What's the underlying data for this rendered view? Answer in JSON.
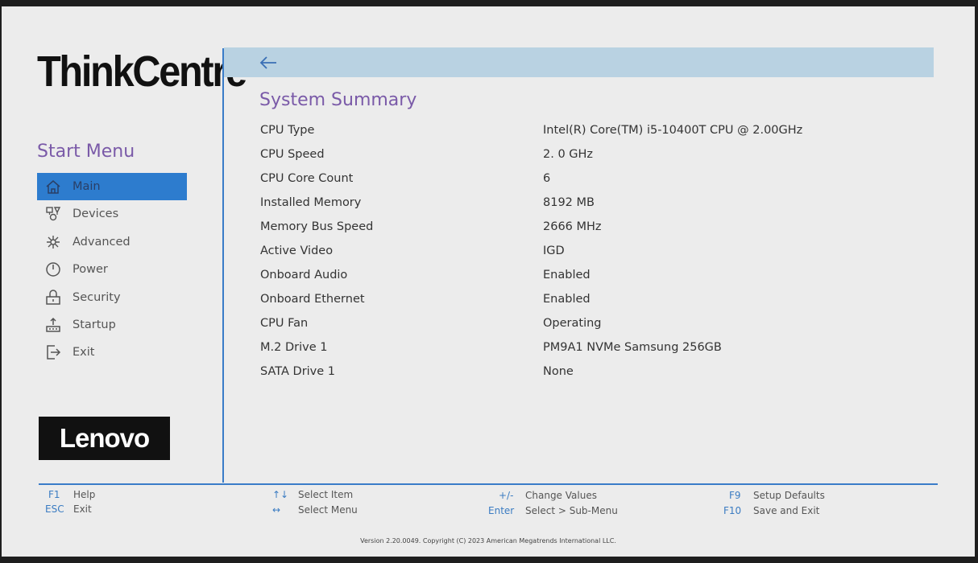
{
  "brand": {
    "name": "ThinkCentre",
    "vendor_logo": "Lenovo"
  },
  "sidebar": {
    "title": "Start Menu",
    "items": [
      {
        "label": "Main",
        "icon": "home-icon",
        "selected": true
      },
      {
        "label": "Devices",
        "icon": "devices-icon",
        "selected": false
      },
      {
        "label": "Advanced",
        "icon": "advanced-icon",
        "selected": false
      },
      {
        "label": "Power",
        "icon": "power-icon",
        "selected": false
      },
      {
        "label": "Security",
        "icon": "lock-icon",
        "selected": false
      },
      {
        "label": "Startup",
        "icon": "startup-icon",
        "selected": false
      },
      {
        "label": "Exit",
        "icon": "exit-icon",
        "selected": false
      }
    ]
  },
  "main": {
    "back_icon": "back-arrow-icon",
    "title": "System Summary",
    "rows": [
      {
        "label": "CPU Type",
        "value": "Intel(R) Core(TM) i5-10400T CPU @ 2.00GHz"
      },
      {
        "label": "CPU Speed",
        "value": "2. 0 GHz"
      },
      {
        "label": "CPU Core Count",
        "value": "6"
      },
      {
        "label": "Installed Memory",
        "value": "8192 MB"
      },
      {
        "label": "Memory Bus Speed",
        "value": "2666 MHz"
      },
      {
        "label": "Active Video",
        "value": "IGD"
      },
      {
        "label": "Onboard Audio",
        "value": "Enabled"
      },
      {
        "label": "Onboard Ethernet",
        "value": "Enabled"
      },
      {
        "label": "CPU Fan",
        "value": "Operating"
      },
      {
        "label": "M.2 Drive 1",
        "value": "PM9A1 NVMe Samsung 256GB"
      },
      {
        "label": "SATA Drive 1",
        "value": "None"
      }
    ]
  },
  "footer": {
    "hints": [
      {
        "key": "F1",
        "action": "Help"
      },
      {
        "key": "ESC",
        "action": "Exit"
      },
      {
        "key": "↑↓",
        "action": "Select Item"
      },
      {
        "key": "↔",
        "action": "Select Menu"
      },
      {
        "key": "+/-",
        "action": "Change Values"
      },
      {
        "key": "Enter",
        "action": "Select > Sub-Menu"
      },
      {
        "key": "F9",
        "action": "Setup Defaults"
      },
      {
        "key": "F10",
        "action": "Save and Exit"
      }
    ],
    "copyright": "Version 2.20.0049. Copyright (C) 2023 American Megatrends International LLC."
  },
  "colors": {
    "accent": "#2d7cce",
    "title": "#7a5aa8",
    "topbar": "#b9d2e2",
    "divider": "#3a7cc8"
  }
}
